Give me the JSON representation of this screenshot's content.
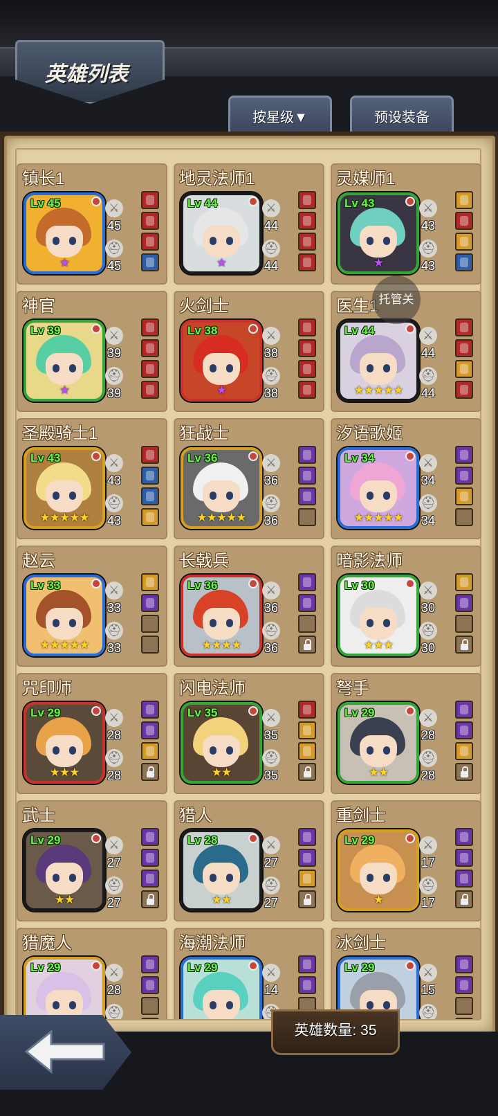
{
  "header": {
    "title": "英雄列表"
  },
  "tabs": {
    "sort": "按星级▼",
    "preset": "预设装备"
  },
  "hosted_label": "托管关",
  "footer": {
    "hero_count": "英雄数量: 35"
  },
  "colors": {
    "accent_green": "#6cf04b",
    "star_gold": "#ffd21e",
    "star_purple": "#c14bff"
  },
  "heroes": [
    {
      "name": "镇长1",
      "level": "Lv 45",
      "weapon": "45",
      "armor": "45",
      "stars": "★",
      "star_color": "purple",
      "frame": "#2a6cd6",
      "bg": "#f0b030",
      "hair": "#c46a2a",
      "slots": [
        "red",
        "red",
        "red",
        "blue"
      ]
    },
    {
      "name": "地灵法师1",
      "level": "Lv 44",
      "weapon": "44",
      "armor": "44",
      "stars": "★",
      "star_color": "purple",
      "frame": "#1a1a1a",
      "bg": "#d8dde0",
      "hair": "#e6e6e6",
      "slots": [
        "red",
        "red",
        "red",
        "red"
      ]
    },
    {
      "name": "灵媒师1",
      "level": "Lv 43",
      "weapon": "43",
      "armor": "43",
      "stars": "★",
      "star_color": "purple",
      "frame": "#34a636",
      "bg": "#3a3542",
      "hair": "#6fd0c2",
      "slots": [
        "gold",
        "red",
        "gold",
        "blue"
      ]
    },
    {
      "name": "神官",
      "level": "Lv 39",
      "weapon": "39",
      "armor": "39",
      "stars": "★",
      "star_color": "purple",
      "frame": "#34a636",
      "bg": "#e8d88a",
      "hair": "#58cfa2",
      "slots": [
        "red",
        "red",
        "red",
        "red"
      ]
    },
    {
      "name": "火剑士",
      "level": "Lv 38",
      "weapon": "38",
      "armor": "38",
      "stars": "★",
      "star_color": "purple",
      "frame": "#c83228",
      "bg": "#c84628",
      "hair": "#d62c22",
      "slots": [
        "red",
        "red",
        "red",
        "red"
      ]
    },
    {
      "name": "医生1",
      "level": "Lv 44",
      "weapon": "44",
      "armor": "44",
      "stars": "★★★★★",
      "star_color": "gold",
      "frame": "#1a1a1a",
      "bg": "#d9d0e0",
      "hair": "#b8a6cc",
      "slots": [
        "red",
        "red",
        "gold",
        "red"
      ]
    },
    {
      "name": "圣殿骑士1",
      "level": "Lv 43",
      "weapon": "43",
      "armor": "43",
      "stars": "★★★★★",
      "star_color": "gold",
      "frame": "#d6a01e",
      "bg": "#b08040",
      "hair": "#f2dc8a",
      "slots": [
        "red",
        "blue",
        "blue",
        "gold"
      ]
    },
    {
      "name": "狂战士",
      "level": "Lv 36",
      "weapon": "36",
      "armor": "36",
      "stars": "★★★★★",
      "star_color": "gold",
      "frame": "#d6a01e",
      "bg": "#6a6a6a",
      "hair": "#f0f0f0",
      "slots": [
        "purple",
        "purple",
        "purple",
        "empty"
      ]
    },
    {
      "name": "汐语歌姬",
      "level": "Lv 34",
      "weapon": "34",
      "armor": "34",
      "stars": "★★★★★",
      "star_color": "gold",
      "frame": "#2a6cd6",
      "bg": "#cfa8e0",
      "hair": "#eea6d6",
      "slots": [
        "purple",
        "purple",
        "gold",
        "empty"
      ]
    },
    {
      "name": "赵云",
      "level": "Lv 33",
      "weapon": "33",
      "armor": "33",
      "stars": "★★★★★",
      "star_color": "gold",
      "frame": "#2a6cd6",
      "bg": "#f0c070",
      "hair": "#a4522a",
      "slots": [
        "gold",
        "purple",
        "empty",
        "empty"
      ]
    },
    {
      "name": "长戟兵",
      "level": "Lv 36",
      "weapon": "36",
      "armor": "36",
      "stars": "★★★★",
      "star_color": "gold",
      "frame": "#c83228",
      "bg": "#b8c0c8",
      "hair": "#d84226",
      "slots": [
        "purple",
        "purple",
        "empty",
        "lock"
      ]
    },
    {
      "name": "暗影法师",
      "level": "Lv 30",
      "weapon": "30",
      "armor": "30",
      "stars": "★★★",
      "star_color": "gold",
      "frame": "#34a636",
      "bg": "#eeeeee",
      "hair": "#dcdcdc",
      "slots": [
        "gold",
        "purple",
        "empty",
        "lock"
      ]
    },
    {
      "name": "咒印师",
      "level": "Lv 29",
      "weapon": "28",
      "armor": "28",
      "stars": "★★★",
      "star_color": "gold",
      "frame": "#c83228",
      "bg": "#5a4a3a",
      "hair": "#e8a24a",
      "slots": [
        "purple",
        "purple",
        "gold",
        "lock"
      ]
    },
    {
      "name": "闪电法师",
      "level": "Lv 35",
      "weapon": "35",
      "armor": "35",
      "stars": "★★",
      "star_color": "gold",
      "frame": "#34a636",
      "bg": "#5a4434",
      "hair": "#f2d27a",
      "slots": [
        "red",
        "gold",
        "gold",
        "lock"
      ]
    },
    {
      "name": "弩手",
      "level": "Lv 29",
      "weapon": "28",
      "armor": "28",
      "stars": "★★",
      "star_color": "gold",
      "frame": "#34a636",
      "bg": "#c8c0b4",
      "hair": "#3a4050",
      "slots": [
        "purple",
        "purple",
        "gold",
        "lock"
      ]
    },
    {
      "name": "武士",
      "level": "Lv 29",
      "weapon": "27",
      "armor": "27",
      "stars": "★★",
      "star_color": "gold",
      "frame": "#1a1a1a",
      "bg": "#6a5a4a",
      "hair": "#5a3a7a",
      "slots": [
        "purple",
        "purple",
        "purple",
        "lock"
      ]
    },
    {
      "name": "猎人",
      "level": "Lv 28",
      "weapon": "27",
      "armor": "27",
      "stars": "★★",
      "star_color": "gold",
      "frame": "#1a1a1a",
      "bg": "#c8d0d0",
      "hair": "#2a6a8a",
      "slots": [
        "purple",
        "purple",
        "gold",
        "lock"
      ]
    },
    {
      "name": "重剑士",
      "level": "Lv 29",
      "weapon": "17",
      "armor": "17",
      "stars": "★",
      "star_color": "gold",
      "frame": "#d6a01e",
      "bg": "#c89050",
      "hair": "#f0b060",
      "slots": [
        "purple",
        "purple",
        "purple",
        "lock"
      ]
    },
    {
      "name": "猎魔人",
      "level": "Lv 29",
      "weapon": "28",
      "armor": "",
      "stars": "",
      "star_color": "gold",
      "frame": "#d6a01e",
      "bg": "#e0d0e0",
      "hair": "#d8c0e6",
      "slots": [
        "purple",
        "purple",
        "empty",
        "empty"
      ]
    },
    {
      "name": "海潮法师",
      "level": "Lv 29",
      "weapon": "14",
      "armor": "",
      "stars": "",
      "star_color": "gold",
      "frame": "#2a6cd6",
      "bg": "#b8e0d8",
      "hair": "#5ad0c0",
      "slots": [
        "purple",
        "purple",
        "empty",
        "empty"
      ]
    },
    {
      "name": "冰剑士",
      "level": "Lv 29",
      "weapon": "15",
      "armor": "",
      "stars": "",
      "star_color": "gold",
      "frame": "#2a6cd6",
      "bg": "#c0d0e0",
      "hair": "#9aa0aa",
      "slots": [
        "purple",
        "purple",
        "empty",
        "empty"
      ]
    }
  ]
}
